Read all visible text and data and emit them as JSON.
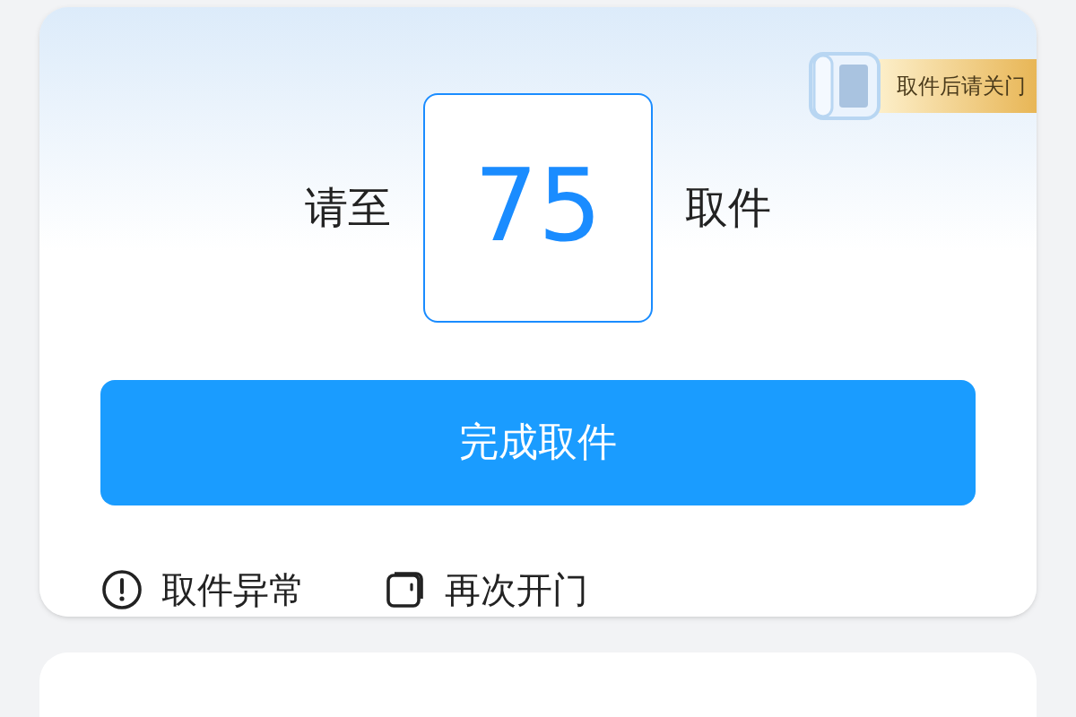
{
  "badge": {
    "label": "取件后请关门"
  },
  "pickup": {
    "prefix": "请至",
    "compartment": "75",
    "suffix": "取件"
  },
  "primary_button": {
    "label": "完成取件"
  },
  "actions": [
    {
      "kind": "warning",
      "label": "取件异常"
    },
    {
      "kind": "door",
      "label": "再次开门"
    }
  ]
}
